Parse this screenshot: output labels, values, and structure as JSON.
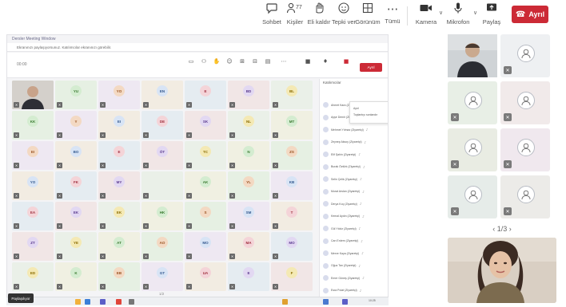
{
  "toolbar": {
    "chat": {
      "label": "Sohbet",
      "icon": "chat-icon"
    },
    "people": {
      "label": "Kişiler",
      "icon": "people-icon",
      "count": "77"
    },
    "raise": {
      "label": "Eli kaldır",
      "icon": "raise-hand-icon"
    },
    "react": {
      "label": "Tepki ver",
      "icon": "react-icon"
    },
    "view": {
      "label": "Görünüm",
      "icon": "view-icon"
    },
    "more": {
      "label": "Tümü",
      "icon": "more-icon"
    },
    "camera": {
      "label": "Kamera",
      "icon": "camera-icon"
    },
    "mic": {
      "label": "Mikrofon",
      "icon": "microphone-icon"
    },
    "share": {
      "label": "Paylaş",
      "icon": "share-icon"
    },
    "leave": {
      "label": "Ayrıl",
      "icon": "phone-hangup-icon",
      "color": "#cc2a36"
    }
  },
  "shared_screen": {
    "title": "Dersler Meeting Window",
    "notice": "Ekranınızı paylaşıyorsunuz. Katılımcılar ekranınızı görebilir.",
    "time": "00:00",
    "leave_label": "Ayrıl",
    "page_indicator": "1/2",
    "participants_header": "Katılımcılar",
    "dropdown_items": [
      "Ayrıl",
      "Toplantıyı sonlandır"
    ],
    "tiles": [
      "",
      "YU",
      "YO",
      "EN",
      "E",
      "BD",
      "BL",
      "KK",
      "Y",
      "EI",
      "DE",
      "SK",
      "NL",
      "MT",
      "EI",
      "BO",
      "E",
      "ÖT",
      "TC",
      "N",
      "ZS",
      "YO",
      "FK",
      "MY",
      "",
      "AK",
      "YL",
      "KB",
      "EA",
      "EK",
      "EK",
      "HK",
      "S",
      "SM",
      "T",
      "ZT",
      "YE",
      "AT",
      "AO",
      "MO",
      "MA",
      "MO",
      "ED",
      "K",
      "EB",
      "GT",
      "UA",
      "E",
      "F"
    ],
    "participant_rows": [
      "Ahmet Kara (Ziyaretçi)",
      "Ayşe Demir (Ziyaretçi)",
      "Mehmet Yılmaz (Ziyaretçi)",
      "Zeynep Aksoy (Ziyaretçi)",
      "Elif Şahin (Ziyaretçi)",
      "Burak Öztürk (Ziyaretçi)",
      "Selin Çelik (Ziyaretçi)",
      "Murat Arslan (Ziyaretçi)",
      "Derya Koç (Ziyaretçi)",
      "Kemal Aydın (Ziyaretçi)",
      "Gül Yıldız (Ziyaretçi)",
      "Can Erdem (Ziyaretçi)",
      "Merve Kaya (Ziyaretçi)",
      "Oğuz Tan (Ziyaretçi)",
      "Emre Güneş (Ziyaretçi)",
      "Esra Polat (Ziyaretçi)"
    ],
    "taskbar_time": "10:25"
  },
  "screen_share_badge": "Paylaşılıyor",
  "gallery": {
    "pager": "1/3",
    "tiles": 8
  }
}
